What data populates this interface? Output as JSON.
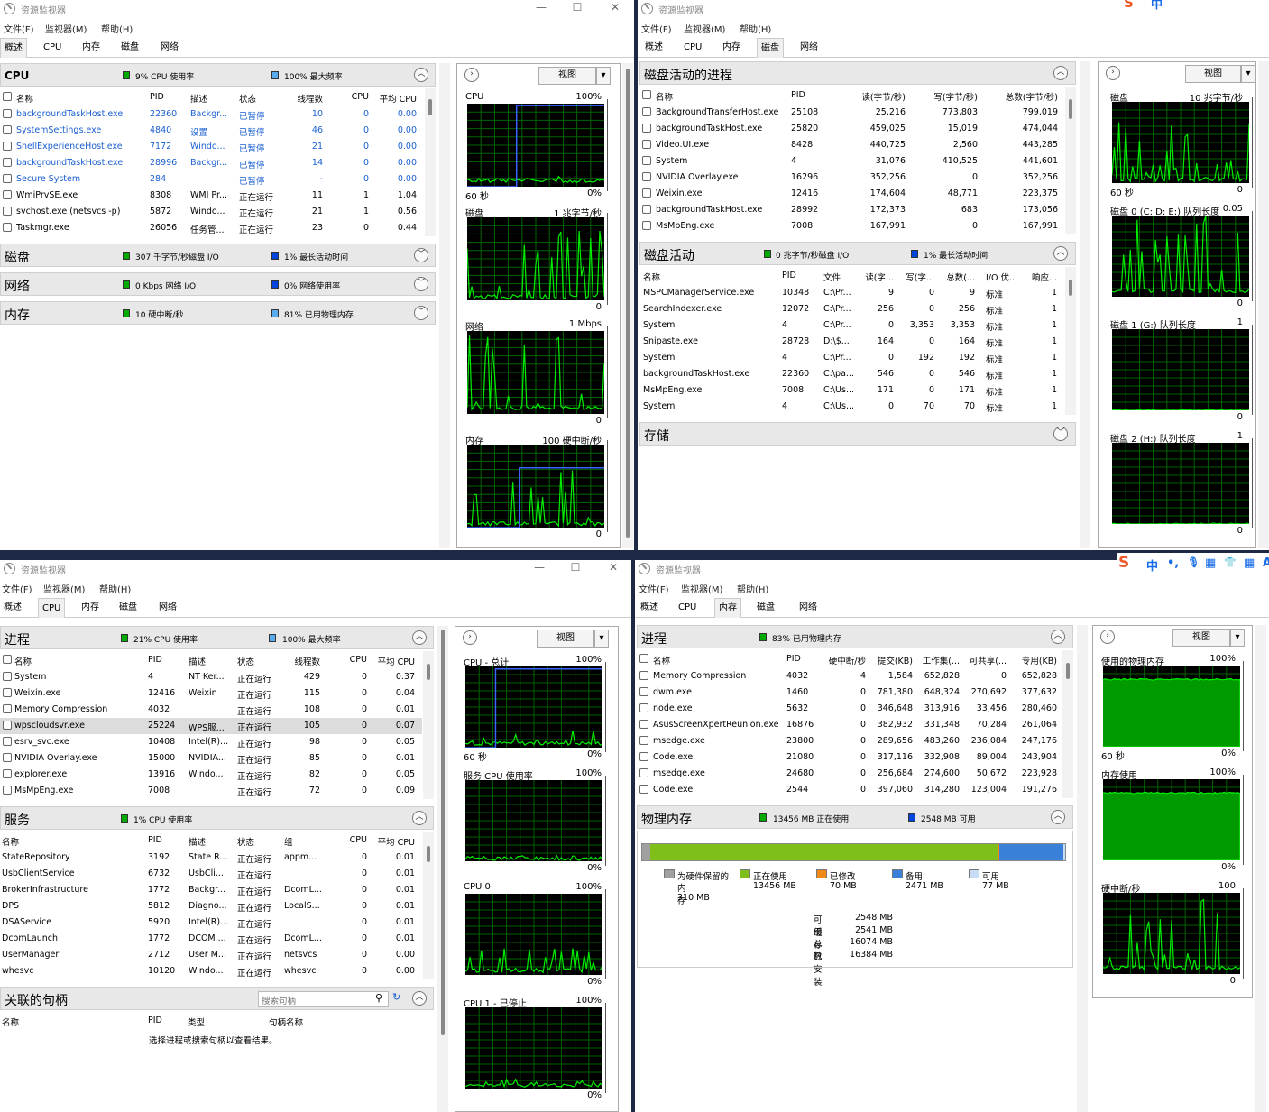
{
  "colors": {
    "graph_bg": "#000000",
    "graph_grid": "#006400",
    "graph_line": "#00ee00",
    "graph_blue": "#3a63ff",
    "accent_blue": "#1a5fd0"
  },
  "app_title": "资源监视器",
  "menu": [
    "文件(F)",
    "监视器(M)",
    "帮助(H)"
  ],
  "tabs": [
    "概述",
    "CPU",
    "内存",
    "磁盘",
    "网络"
  ],
  "view_label": "视图",
  "ime": {
    "chars": [
      "中",
      "•,",
      "🎙",
      "▦",
      "👕",
      "▦"
    ],
    "last": "A"
  },
  "w1": {
    "cpu": {
      "title": "CPU",
      "s1": "9% CPU 使用率",
      "s2": "100% 最大频率",
      "cols": [
        "名称",
        "PID",
        "描述",
        "状态",
        "线程数",
        "CPU",
        "平均 CPU"
      ],
      "rows": [
        {
          "n": "backgroundTaskHost.exe",
          "pid": "22360",
          "d": "Backgr...",
          "st": "已暂停",
          "th": "10",
          "c": "0",
          "a": "0.00",
          "blue": true
        },
        {
          "n": "SystemSettings.exe",
          "pid": "4840",
          "d": "设置",
          "st": "已暂停",
          "th": "46",
          "c": "0",
          "a": "0.00",
          "blue": true
        },
        {
          "n": "ShellExperienceHost.exe",
          "pid": "7172",
          "d": "Windo...",
          "st": "已暂停",
          "th": "21",
          "c": "0",
          "a": "0.00",
          "blue": true
        },
        {
          "n": "backgroundTaskHost.exe",
          "pid": "28996",
          "d": "Backgr...",
          "st": "已暂停",
          "th": "14",
          "c": "0",
          "a": "0.00",
          "blue": true
        },
        {
          "n": "Secure System",
          "pid": "284",
          "d": "",
          "st": "已暂停",
          "th": "-",
          "c": "0",
          "a": "0.00",
          "blue": true
        },
        {
          "n": "WmiPrvSE.exe",
          "pid": "8308",
          "d": "WMI Pr...",
          "st": "正在运行",
          "th": "11",
          "c": "1",
          "a": "1.04",
          "blue": false
        },
        {
          "n": "svchost.exe (netsvcs -p)",
          "pid": "5872",
          "d": "Windo...",
          "st": "正在运行",
          "th": "21",
          "c": "1",
          "a": "0.56",
          "blue": false
        },
        {
          "n": "Taskmgr.exe",
          "pid": "26056",
          "d": "任务管...",
          "st": "正在运行",
          "th": "23",
          "c": "0",
          "a": "0.44",
          "blue": false
        }
      ]
    },
    "disk": {
      "title": "磁盘",
      "s1": "307 千字节/秒磁盘 I/O",
      "s2": "1% 最长活动时间"
    },
    "net": {
      "title": "网络",
      "s1": "0 Kbps 网络 I/O",
      "s2": "0% 网络使用率"
    },
    "mem": {
      "title": "内存",
      "s1": "10 硬中断/秒",
      "s2": "81% 已用物理内存"
    },
    "graphs": [
      {
        "label": "CPU",
        "max": "100%",
        "foot_l": "60 秒",
        "foot_r": "0%"
      },
      {
        "label": "磁盘",
        "max": "1 兆字节/秒",
        "foot_l": "",
        "foot_r": "0"
      },
      {
        "label": "网络",
        "max": "1 Mbps",
        "foot_l": "",
        "foot_r": "0"
      },
      {
        "label": "内存",
        "max": "100 硬中断/秒",
        "foot_l": "",
        "foot_r": "0"
      }
    ]
  },
  "w2": {
    "proc": {
      "title": "磁盘活动的进程",
      "cols": [
        "名称",
        "PID",
        "读(字节/秒)",
        "写(字节/秒)",
        "总数(字节/秒)"
      ],
      "rows": [
        [
          "BackgroundTransferHost.exe",
          "25108",
          "25,216",
          "773,803",
          "799,019"
        ],
        [
          "backgroundTaskHost.exe",
          "25820",
          "459,025",
          "15,019",
          "474,044"
        ],
        [
          "Video.UI.exe",
          "8428",
          "440,725",
          "2,560",
          "443,285"
        ],
        [
          "System",
          "4",
          "31,076",
          "410,525",
          "441,601"
        ],
        [
          "NVIDIA Overlay.exe",
          "16296",
          "352,256",
          "0",
          "352,256"
        ],
        [
          "Weixin.exe",
          "12416",
          "174,604",
          "48,771",
          "223,375"
        ],
        [
          "backgroundTaskHost.exe",
          "28992",
          "172,373",
          "683",
          "173,056"
        ],
        [
          "MsMpEng.exe",
          "7008",
          "167,991",
          "0",
          "167,991"
        ]
      ]
    },
    "act": {
      "title": "磁盘活动",
      "s1": "0 兆字节/秒磁盘 I/O",
      "s2": "1% 最长活动时间",
      "cols": [
        "名称",
        "PID",
        "文件",
        "读(字...",
        "写(字...",
        "总数(...",
        "I/O 优...",
        "响应..."
      ],
      "rows": [
        [
          "MSPCManagerService.exe",
          "10348",
          "C:\\Pr...",
          "9",
          "0",
          "9",
          "标准",
          "1"
        ],
        [
          "SearchIndexer.exe",
          "12072",
          "C:\\Pr...",
          "256",
          "0",
          "256",
          "标准",
          "1"
        ],
        [
          "System",
          "4",
          "C:\\Pr...",
          "0",
          "3,353",
          "3,353",
          "标准",
          "1"
        ],
        [
          "Snipaste.exe",
          "28728",
          "D:\\$...",
          "164",
          "0",
          "164",
          "标准",
          "1"
        ],
        [
          "System",
          "4",
          "C:\\Pr...",
          "0",
          "192",
          "192",
          "标准",
          "1"
        ],
        [
          "backgroundTaskHost.exe",
          "22360",
          "C:\\pa...",
          "546",
          "0",
          "546",
          "标准",
          "1"
        ],
        [
          "MsMpEng.exe",
          "7008",
          "C:\\Us...",
          "171",
          "0",
          "171",
          "标准",
          "1"
        ],
        [
          "System",
          "4",
          "C:\\Us...",
          "0",
          "70",
          "70",
          "标准",
          "1"
        ]
      ]
    },
    "store": {
      "title": "存储"
    },
    "graphs": [
      {
        "label": "磁盘",
        "max": "10 兆字节/秒",
        "foot_l": "60 秒",
        "foot_r": "0"
      },
      {
        "label": "磁盘 0 (C: D: E:) 队列长度",
        "max": "0.05",
        "foot_l": "",
        "foot_r": "0"
      },
      {
        "label": "磁盘 1 (G:) 队列长度",
        "max": "1",
        "foot_l": "",
        "foot_r": "0"
      },
      {
        "label": "磁盘 2 (H:) 队列长度",
        "max": "1",
        "foot_l": "",
        "foot_r": "0"
      }
    ]
  },
  "w3": {
    "proc": {
      "title": "进程",
      "s1": "21% CPU 使用率",
      "s2": "100% 最大频率",
      "cols": [
        "名称",
        "PID",
        "描述",
        "状态",
        "线程数",
        "CPU",
        "平均 CPU"
      ],
      "rows": [
        [
          "System",
          "4",
          "NT Ker...",
          "正在运行",
          "429",
          "0",
          "0.37"
        ],
        [
          "Weixin.exe",
          "12416",
          "Weixin",
          "正在运行",
          "115",
          "0",
          "0.04"
        ],
        [
          "Memory Compression",
          "4032",
          "",
          "正在运行",
          "108",
          "0",
          "0.01"
        ],
        [
          "wpscloudsvr.exe",
          "25224",
          "WPS服...",
          "正在运行",
          "105",
          "0",
          "0.07"
        ],
        [
          "esrv_svc.exe",
          "10408",
          "Intel(R)...",
          "正在运行",
          "98",
          "0",
          "0.05"
        ],
        [
          "NVIDIA Overlay.exe",
          "15000",
          "NVIDIA...",
          "正在运行",
          "85",
          "0",
          "0.01"
        ],
        [
          "explorer.exe",
          "13916",
          "Windo...",
          "正在运行",
          "82",
          "0",
          "0.05"
        ],
        [
          "MsMpEng.exe",
          "7008",
          "",
          "正在运行",
          "72",
          "0",
          "0.09"
        ]
      ]
    },
    "svc": {
      "title": "服务",
      "s1": "1% CPU 使用率",
      "cols": [
        "名称",
        "PID",
        "描述",
        "状态",
        "组",
        "CPU",
        "平均 CPU"
      ],
      "rows": [
        [
          "StateRepository",
          "3192",
          "State R...",
          "正在运行",
          "appm...",
          "0",
          "0.01"
        ],
        [
          "UsbClientService",
          "6732",
          "UsbCli...",
          "正在运行",
          "",
          "0",
          "0.01"
        ],
        [
          "BrokerInfrastructure",
          "1772",
          "Backgr...",
          "正在运行",
          "DcomL...",
          "0",
          "0.01"
        ],
        [
          "DPS",
          "5812",
          "Diagno...",
          "正在运行",
          "LocalS...",
          "0",
          "0.01"
        ],
        [
          "DSAService",
          "5920",
          "Intel(R)...",
          "正在运行",
          "",
          "0",
          "0.01"
        ],
        [
          "DcomLaunch",
          "1772",
          "DCOM ...",
          "正在运行",
          "DcomL...",
          "0",
          "0.01"
        ],
        [
          "UserManager",
          "2712",
          "User M...",
          "正在运行",
          "netsvcs",
          "0",
          "0.00"
        ],
        [
          "whesvc",
          "10120",
          "Windo...",
          "正在运行",
          "whesvc",
          "0",
          "0.00"
        ]
      ]
    },
    "handles": {
      "title": "关联的句柄",
      "search_placeholder": "搜索句柄",
      "cols": [
        "名称",
        "PID",
        "类型",
        "句柄名称"
      ],
      "empty": "选择进程或搜索句柄以查看结果。"
    },
    "graphs": [
      {
        "label": "CPU - 总计",
        "max": "100%",
        "foot_l": "60 秒",
        "foot_r": "0%"
      },
      {
        "label": "服务 CPU 使用率",
        "max": "100%",
        "foot_l": "",
        "foot_r": "0%"
      },
      {
        "label": "CPU 0",
        "max": "100%",
        "foot_l": "",
        "foot_r": "0%"
      },
      {
        "label": "CPU 1 - 已停止",
        "max": "100%",
        "foot_l": "",
        "foot_r": "0%"
      }
    ]
  },
  "w4": {
    "proc": {
      "title": "进程",
      "s1": "83% 已用物理内存",
      "cols": [
        "名称",
        "PID",
        "硬中断/秒",
        "提交(KB)",
        "工作集(...",
        "可共享(...",
        "专用(KB)"
      ],
      "rows": [
        [
          "Memory Compression",
          "4032",
          "4",
          "1,584",
          "652,828",
          "0",
          "652,828"
        ],
        [
          "dwm.exe",
          "1460",
          "0",
          "781,380",
          "648,324",
          "270,692",
          "377,632"
        ],
        [
          "node.exe",
          "5632",
          "0",
          "346,648",
          "313,916",
          "33,456",
          "280,460"
        ],
        [
          "AsusScreenXpertReunion.exe",
          "16876",
          "0",
          "382,932",
          "331,348",
          "70,284",
          "261,064"
        ],
        [
          "msedge.exe",
          "23800",
          "0",
          "289,656",
          "483,260",
          "236,084",
          "247,176"
        ],
        [
          "Code.exe",
          "21080",
          "0",
          "317,116",
          "332,908",
          "89,004",
          "243,904"
        ],
        [
          "msedge.exe",
          "24680",
          "0",
          "256,684",
          "274,600",
          "50,672",
          "223,928"
        ],
        [
          "Code.exe",
          "2544",
          "0",
          "397,060",
          "314,280",
          "123,004",
          "191,276"
        ]
      ]
    },
    "phys": {
      "title": "物理内存",
      "s1": "13456 MB 正在使用",
      "s2": "2548 MB 可用",
      "bar": {
        "reserved_pct": 0.019,
        "inuse_pct": 0.822,
        "modified_pct": 0.004,
        "standby_pct": 0.151,
        "free_pct": 0.004
      },
      "legend": [
        {
          "label": "为硬件保留的",
          "sub": "内存",
          "val": "310 MB",
          "color": "#a0a0a0"
        },
        {
          "label": "正在使用",
          "sub": "",
          "val": "13456 MB",
          "color": "#7fbf1a"
        },
        {
          "label": "已修改",
          "sub": "",
          "val": "70 MB",
          "color": "#f08a1a"
        },
        {
          "label": "备用",
          "sub": "",
          "val": "2471 MB",
          "color": "#3a7fd8"
        },
        {
          "label": "可用",
          "sub": "",
          "val": "77 MB",
          "color": "#c7dcf5"
        }
      ],
      "summary": [
        [
          "可用",
          "2548 MB"
        ],
        [
          "缓存",
          "2541 MB"
        ],
        [
          "总数",
          "16074 MB"
        ],
        [
          "已安装",
          "16384 MB"
        ]
      ]
    },
    "graphs": [
      {
        "label": "使用的物理内存",
        "max": "100%",
        "foot_l": "60 秒",
        "foot_r": "0%"
      },
      {
        "label": "内存使用",
        "max": "100%",
        "foot_l": "",
        "foot_r": "0%"
      },
      {
        "label": "硬中断/秒",
        "max": "100",
        "foot_l": "",
        "foot_r": "0"
      }
    ]
  }
}
